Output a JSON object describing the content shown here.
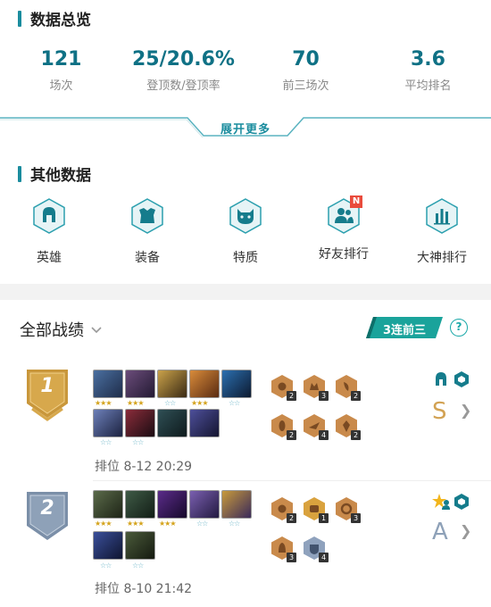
{
  "overview": {
    "title": "数据总览",
    "stats": [
      {
        "value": "121",
        "label": "场次"
      },
      {
        "value": "25/20.6%",
        "label": "登顶数/登顶率"
      },
      {
        "value": "70",
        "label": "前三场次"
      },
      {
        "value": "3.6",
        "label": "平均排名"
      }
    ],
    "expand_label": "展开更多"
  },
  "other": {
    "title": "其他数据",
    "items": [
      {
        "label": "英雄",
        "icon": "helmet-icon"
      },
      {
        "label": "装备",
        "icon": "armor-icon"
      },
      {
        "label": "特质",
        "icon": "cat-face-icon"
      },
      {
        "label": "好友排行",
        "icon": "friends-icon",
        "badge": "N"
      },
      {
        "label": "大神排行",
        "icon": "bar-chart-icon"
      }
    ]
  },
  "records": {
    "title": "全部战绩",
    "streak": "3连前三",
    "help": "?",
    "matches": [
      {
        "place": "1",
        "rank_time": "排位  8-12 20:29",
        "grade": "S",
        "item_counts": [
          "2",
          "3",
          "2",
          "2",
          "4",
          "2"
        ]
      },
      {
        "place": "2",
        "rank_time": "排位  8-10 21:42",
        "grade": "A",
        "item_counts": [
          "2",
          "1",
          "3",
          "3",
          "4"
        ]
      }
    ]
  },
  "colors": {
    "accent": "#1a8c9e",
    "gold": "#c9973b",
    "silver": "#7b8fa8"
  }
}
